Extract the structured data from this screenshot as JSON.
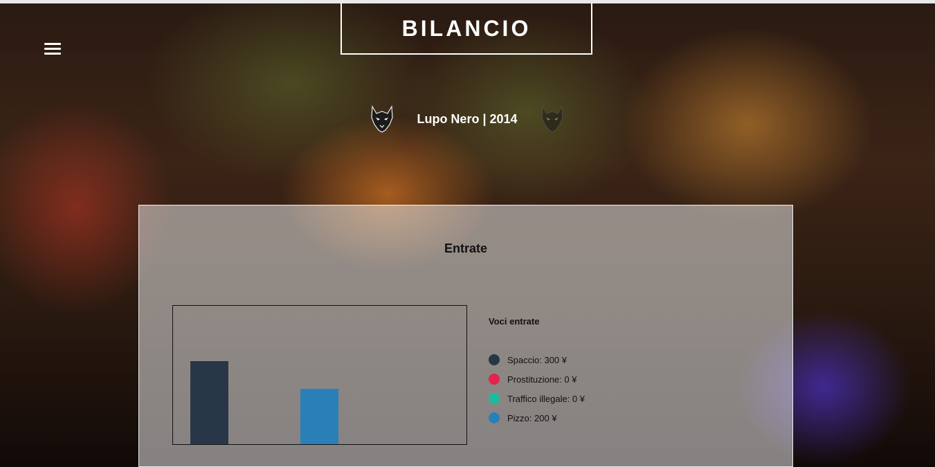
{
  "header": {
    "title": "BILANCIO",
    "subtitle": "Lupo Nero | 2014"
  },
  "icons": {
    "menu": "hamburger-menu-icon",
    "wolf_left": "wolf-head-icon",
    "wolf_right": "wolf-head-icon"
  },
  "panel": {
    "title": "Entrate",
    "legend_title": "Voci entrate",
    "legend": [
      {
        "label": "Spaccio: 300 ¥",
        "color": "#283747"
      },
      {
        "label": "Prostituzione: 0 ¥",
        "color": "#e4234e"
      },
      {
        "label": "Traffico illegale: 0 ¥",
        "color": "#1abc9c"
      },
      {
        "label": "Pizzo: 200 ¥",
        "color": "#2980b9"
      }
    ]
  },
  "chart_data": {
    "type": "bar",
    "categories": [
      "Spaccio",
      "Prostituzione",
      "Traffico illegale",
      "Pizzo"
    ],
    "values": [
      300,
      0,
      0,
      200
    ],
    "colors": [
      "#283747",
      "#e4234e",
      "#1abc9c",
      "#2980b9"
    ],
    "title": "Entrate",
    "legend_title": "Voci entrate",
    "unit": "¥",
    "ylim": [
      0,
      500
    ],
    "grid": false,
    "legend_position": "right"
  }
}
